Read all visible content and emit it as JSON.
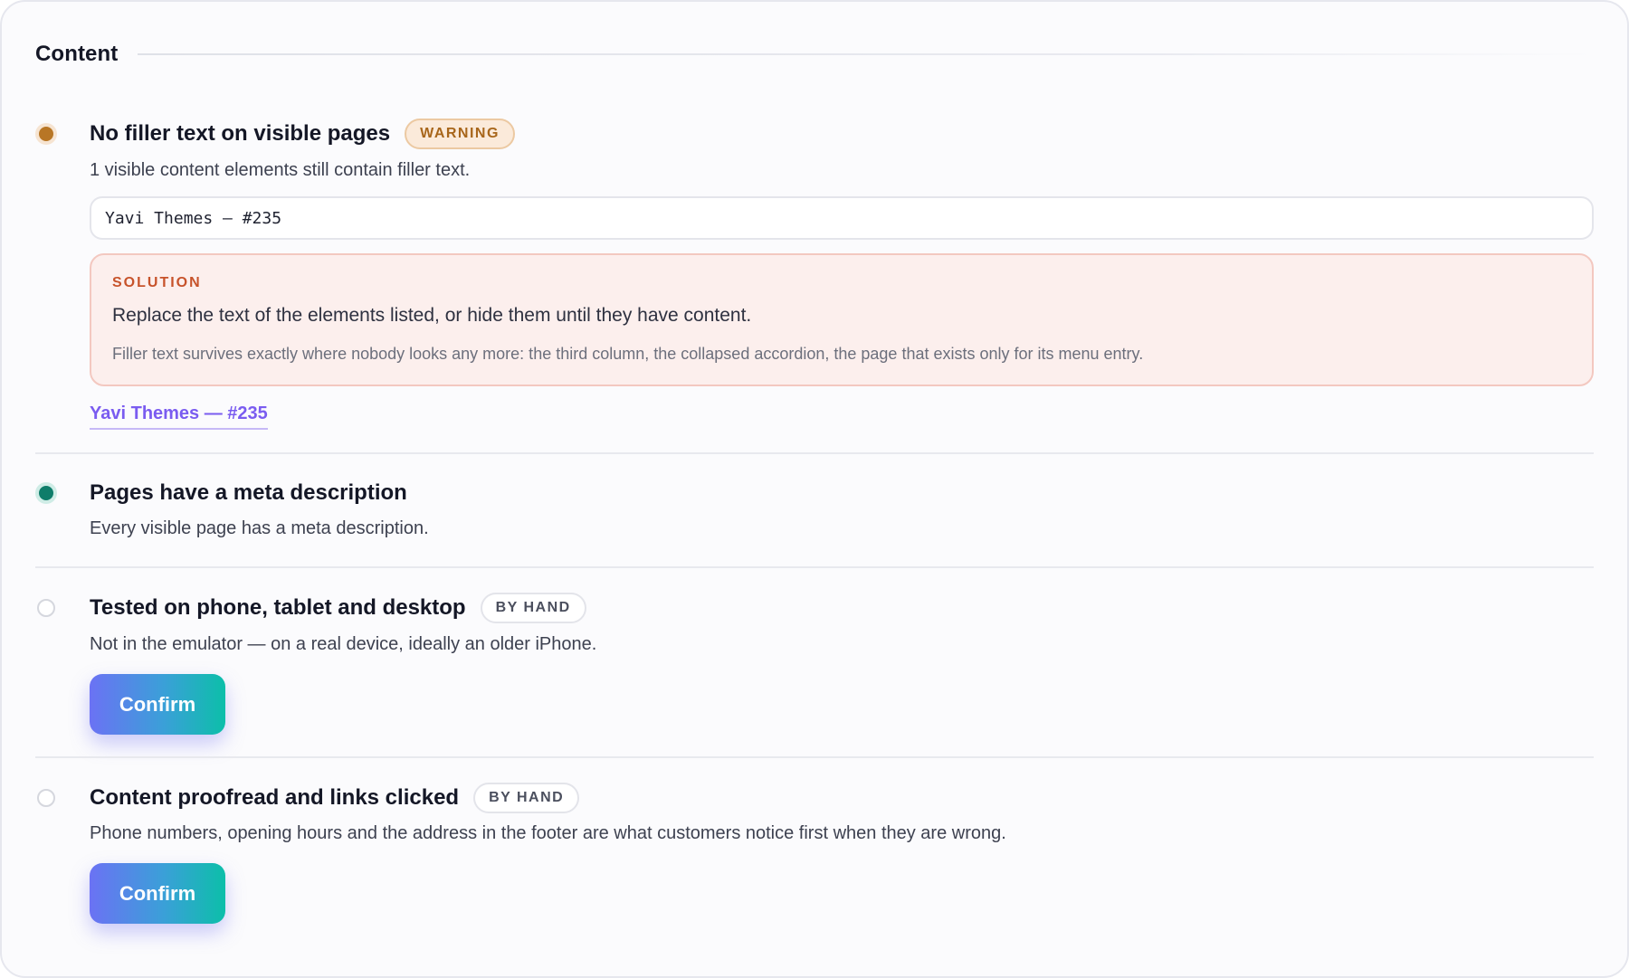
{
  "section": {
    "title": "Content"
  },
  "items": [
    {
      "title": "No filler text on visible pages",
      "badge": "WARNING",
      "description": "1 visible content elements still contain filler text.",
      "element": "Yavi Themes – #235",
      "solution": {
        "label": "SOLUTION",
        "text": "Replace the text of the elements listed, or hide them until they have content.",
        "note": "Filler text survives exactly where nobody looks any more: the third column, the collapsed accordion, the page that exists only for its menu entry."
      },
      "link": "Yavi Themes — #235"
    },
    {
      "title": "Pages have a meta description",
      "description": "Every visible page has a meta description."
    },
    {
      "title": "Tested on phone, tablet and desktop",
      "badge": "BY HAND",
      "description": "Not in the emulator — on a real device, ideally an older iPhone.",
      "button": "Confirm"
    },
    {
      "title": "Content proofread and links clicked",
      "badge": "BY HAND",
      "description": "Phone numbers, opening hours and the address in the footer are what customers notice first when they are wrong.",
      "button": "Confirm"
    }
  ],
  "colors": {
    "warning": "#b87625",
    "success": "#0e7d6a",
    "solution_label": "#c7532b",
    "link": "#7a5cf0",
    "button_gradient_start": "#6b72f4",
    "button_gradient_end": "#0cbfa9"
  }
}
